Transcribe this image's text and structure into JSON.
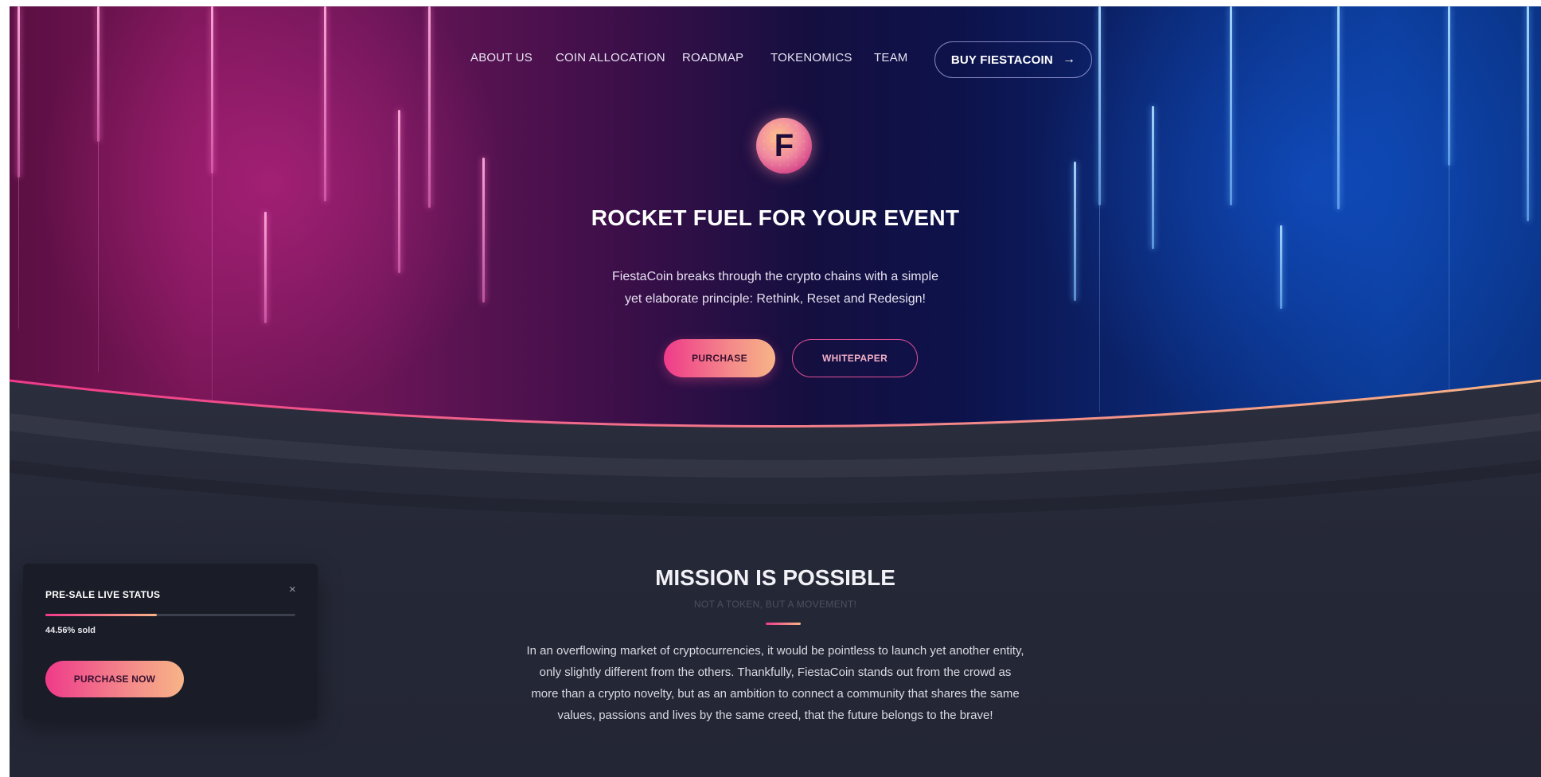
{
  "nav": {
    "links": [
      "ABOUT US",
      "COIN ALLOCATION",
      "ROADMAP",
      "TOKENOMICS",
      "TEAM"
    ],
    "buy_label": "BUY FIESTACOIN",
    "buy_arrow": "→"
  },
  "hero": {
    "logo_letter": "F",
    "title": "ROCKET FUEL FOR YOUR EVENT",
    "description_lines": [
      "FiestaCoin breaks through the crypto chains with a simple",
      "yet elaborate principle: Rethink, Reset and Redesign!"
    ],
    "purchase_label": "PURCHASE",
    "whitepaper_label": "WHITEPAPER"
  },
  "mission": {
    "title": "MISSION IS POSSIBLE",
    "subtitle": "NOT A TOKEN, BUT A MOVEMENT!",
    "text_lines": [
      "In an overflowing market of cryptocurrencies, it would be pointless to launch yet another entity,",
      "only slightly different from the others. Thankfully, FiestaCoin stands out from the crowd as",
      "more than a crypto novelty, but as an ambition to connect a community that shares the same",
      "values, passions and lives by the same creed, that the future belongs to the brave!"
    ]
  },
  "presale": {
    "title": "PRE-SALE LIVE STATUS",
    "close_glyph": "×",
    "progress_percent": 44.56,
    "sold_text": "44.56% sold",
    "button_label": "PURCHASE NOW"
  },
  "colors": {
    "accent_pink": "#ef3a8a",
    "accent_peach": "#f7b487",
    "background_dark": "#232634"
  }
}
